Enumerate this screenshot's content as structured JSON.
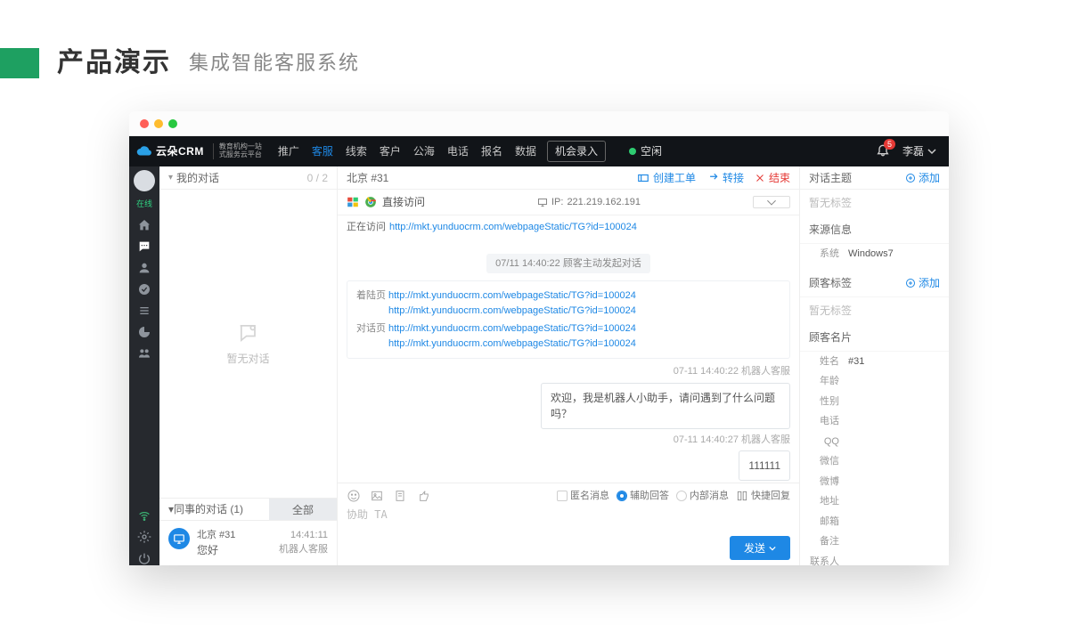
{
  "slide": {
    "title": "产品演示",
    "subtitle": "集成智能客服系统"
  },
  "brand": {
    "name": "云朵CRM",
    "sub1": "教育机构一站",
    "sub2": "式服务云平台"
  },
  "nav": {
    "items": [
      "推广",
      "客服",
      "线索",
      "客户",
      "公海",
      "电话",
      "报名",
      "数据"
    ],
    "active_index": 1,
    "record_btn": "机会录入",
    "idle": "空闲",
    "notif_count": "5",
    "username": "李磊"
  },
  "sidebar": {
    "status": "在线"
  },
  "conv": {
    "my_label": "我的对话",
    "my_count": "0 / 2",
    "empty_text": "暂无对话",
    "peer_label": "同事的对话  (1)",
    "peer_tab": "全部",
    "peer_item": {
      "name": "北京 #31",
      "msg": "您好",
      "time": "14:41:11",
      "source": "机器人客服"
    }
  },
  "chat": {
    "title": "北京 #31",
    "actions": {
      "ticket": "创建工单",
      "transfer": "转接",
      "end": "结束"
    },
    "access": "直接访问",
    "ip_label": "IP:",
    "ip": "221.219.162.191",
    "visit_label": "正在访问",
    "visit_url": "http://mkt.yunduocrm.com/webpageStatic/TG?id=100024",
    "timeline1": "07/11 14:40:22  顾客主动发起对话",
    "landing_label": "着陆页",
    "landing": [
      "http://mkt.yunduocrm.com/webpageStatic/TG?id=100024",
      "http://mkt.yunduocrm.com/webpageStatic/TG?id=100024"
    ],
    "dialog_label": "对话页",
    "dialog": [
      "http://mkt.yunduocrm.com/webpageStatic/TG?id=100024",
      "http://mkt.yunduocrm.com/webpageStatic/TG?id=100024"
    ],
    "meta1": "07-11 14:40:22  机器人客服",
    "bubble1": "欢迎，我是机器人小助手，请问遇到了什么问题吗？",
    "meta2": "07-11 14:40:27  机器人客服",
    "bubble2": "111111",
    "compose": {
      "anon": "匿名消息",
      "assist": "辅助回答",
      "internal": "内部消息",
      "quick": "快捷回复",
      "placeholder": "协助 TA",
      "send": "发送"
    }
  },
  "rpanel": {
    "topic_label": "对话主题",
    "add": "添加",
    "no_tag": "暂无标签",
    "source_label": "来源信息",
    "sys_label": "系统",
    "sys_val": "Windows7",
    "tags_label": "顾客标签",
    "card_label": "顾客名片",
    "kv": [
      {
        "k": "姓名",
        "v": "#31"
      },
      {
        "k": "年龄",
        "v": ""
      },
      {
        "k": "性别",
        "v": ""
      },
      {
        "k": "电话",
        "v": ""
      },
      {
        "k": "QQ",
        "v": ""
      },
      {
        "k": "微信",
        "v": ""
      },
      {
        "k": "微博",
        "v": ""
      },
      {
        "k": "地址",
        "v": ""
      },
      {
        "k": "邮箱",
        "v": ""
      },
      {
        "k": "备注",
        "v": ""
      },
      {
        "k": "联系人",
        "v": ""
      }
    ]
  }
}
